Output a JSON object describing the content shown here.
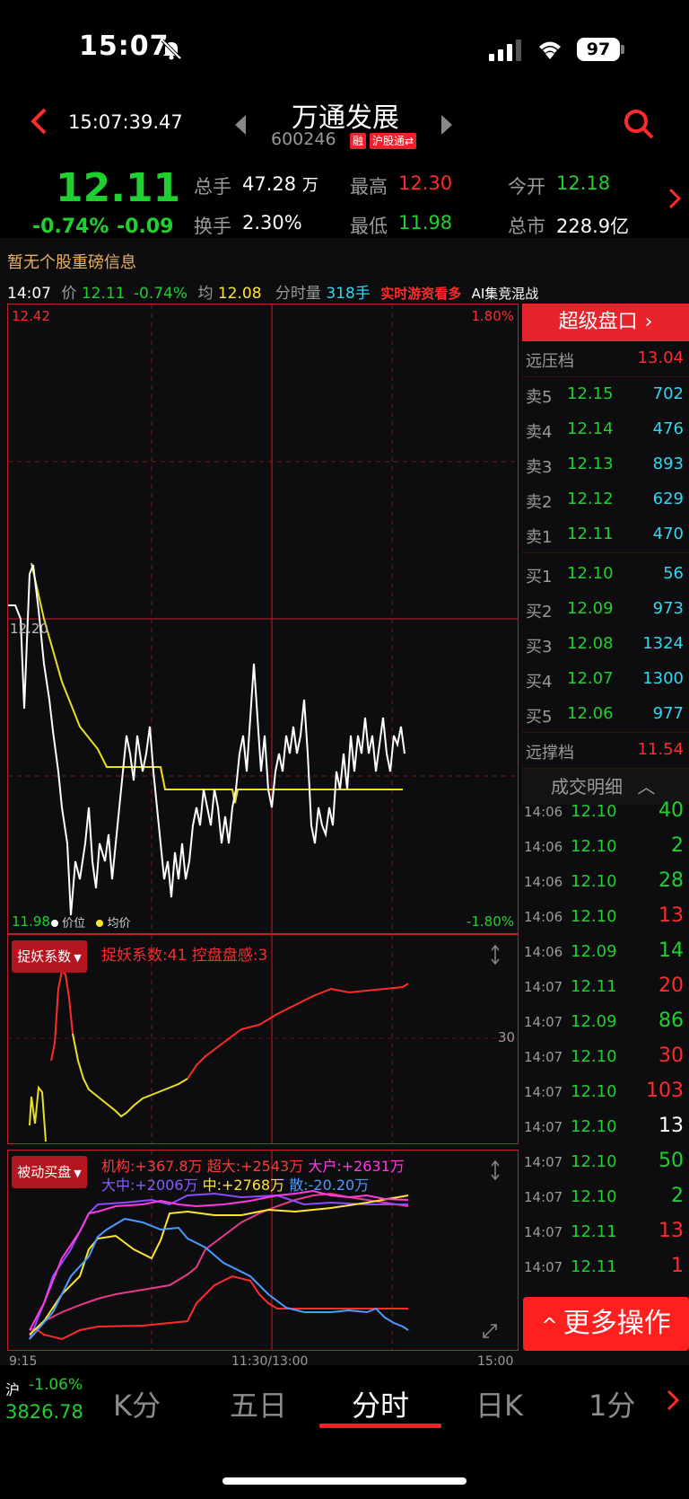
{
  "status_bar": {
    "time": "15:07",
    "signal": "signal-icon",
    "wifi": "wifi-icon",
    "battery": "97"
  },
  "header": {
    "time": "15:07:39.47",
    "stock_name": "万通发展",
    "stock_code": "600246",
    "badge_rong": "融",
    "badge_hgt": "沪股通",
    "badge_hgt_suffix": "⇄"
  },
  "quote": {
    "price": "12.11",
    "change_pct": "-0.74%",
    "change": "-0.09",
    "fields": [
      {
        "label": "总手",
        "value": "47.28",
        "unit": "万"
      },
      {
        "label": "最高",
        "value": "12.30"
      },
      {
        "label": "今开",
        "value": "12.18"
      },
      {
        "label": "换手",
        "value": "2.30%"
      },
      {
        "label": "最低",
        "value": "11.98"
      },
      {
        "label": "总市",
        "value": "228.9亿"
      }
    ]
  },
  "notice": "暂无个股重磅信息",
  "info_line": {
    "time": "14:07",
    "price_label": "价",
    "price": "12.11",
    "pct": "-0.74%",
    "avg_label": "均",
    "avg": "12.08",
    "vol_label": "分时量",
    "vol": "318手",
    "link1": "实时游资看多",
    "link2": "AI集竞混战"
  },
  "main_chart": {
    "high_label": "12.42",
    "high_pct": "1.80%",
    "mid_label": "12.20",
    "low_label": "11.98",
    "low_pct": "-1.80%",
    "legend_price": "价位",
    "legend_avg": "均价"
  },
  "indicator1": {
    "button": "捉妖系数",
    "text": "捉妖系数:41 控盘盘感:3",
    "level": "30"
  },
  "indicator2": {
    "button": "被动买盘",
    "line1": [
      {
        "text": "机构:+367.8万",
        "color": "#ff3a3a"
      },
      {
        "text": "超大:+2543万",
        "color": "#ff3a3a"
      },
      {
        "text": "大户:+2631万",
        "color": "#ff3be0"
      }
    ],
    "line2": [
      {
        "text": "大中:+2006万",
        "color": "#8a5cff"
      },
      {
        "text": "中:+2768万",
        "color": "#ffe52e"
      },
      {
        "text": "散:-20.20万",
        "color": "#4a9cff"
      }
    ]
  },
  "time_axis": {
    "start": "9:15",
    "mid": "11:30/13:00",
    "end": "15:00"
  },
  "orderbook": {
    "title": "超级盘口",
    "far_ask_label": "远压档",
    "far_ask": "13.04",
    "asks": [
      {
        "label": "卖5",
        "price": "12.15",
        "vol": "702"
      },
      {
        "label": "卖4",
        "price": "12.14",
        "vol": "476"
      },
      {
        "label": "卖3",
        "price": "12.13",
        "vol": "893"
      },
      {
        "label": "卖2",
        "price": "12.12",
        "vol": "629"
      },
      {
        "label": "卖1",
        "price": "12.11",
        "vol": "470"
      }
    ],
    "bids": [
      {
        "label": "买1",
        "price": "12.10",
        "vol": "56"
      },
      {
        "label": "买2",
        "price": "12.09",
        "vol": "973"
      },
      {
        "label": "买3",
        "price": "12.08",
        "vol": "1324"
      },
      {
        "label": "买4",
        "price": "12.07",
        "vol": "1300"
      },
      {
        "label": "买5",
        "price": "12.06",
        "vol": "977"
      }
    ],
    "far_bid_label": "远撑档",
    "far_bid": "11.54"
  },
  "trades": {
    "title": "成交明细",
    "rows": [
      {
        "time": "14:06",
        "price": "12.10",
        "vol": "40",
        "color": "#1fd12f"
      },
      {
        "time": "14:06",
        "price": "12.10",
        "vol": "2",
        "color": "#1fd12f"
      },
      {
        "time": "14:06",
        "price": "12.10",
        "vol": "28",
        "color": "#1fd12f"
      },
      {
        "time": "14:06",
        "price": "12.10",
        "vol": "13",
        "color": "#ff2b2b"
      },
      {
        "time": "14:06",
        "price": "12.09",
        "vol": "14",
        "color": "#1fd12f"
      },
      {
        "time": "14:07",
        "price": "12.11",
        "vol": "20",
        "color": "#ff2b2b"
      },
      {
        "time": "14:07",
        "price": "12.09",
        "vol": "86",
        "color": "#1fd12f"
      },
      {
        "time": "14:07",
        "price": "12.10",
        "vol": "30",
        "color": "#ff2b2b"
      },
      {
        "time": "14:07",
        "price": "12.10",
        "vol": "103",
        "color": "#ff2b2b"
      },
      {
        "time": "14:07",
        "price": "12.10",
        "vol": "13",
        "color": "#ffffff"
      },
      {
        "time": "14:07",
        "price": "12.10",
        "vol": "50",
        "color": "#1fd12f"
      },
      {
        "time": "14:07",
        "price": "12.10",
        "vol": "2",
        "color": "#1fd12f"
      },
      {
        "time": "14:07",
        "price": "12.11",
        "vol": "13",
        "color": "#ff2b2b"
      },
      {
        "time": "14:07",
        "price": "12.11",
        "vol": "1",
        "color": "#ff2b2b"
      }
    ]
  },
  "more_button": "更多操作",
  "index": {
    "name": "沪",
    "pct": "-1.06%",
    "value": "3826.78"
  },
  "tabs": [
    {
      "label": "K分",
      "active": false
    },
    {
      "label": "五日",
      "active": false
    },
    {
      "label": "分时",
      "active": true
    },
    {
      "label": "日K",
      "active": false
    },
    {
      "label": "1分",
      "active": false
    }
  ]
}
